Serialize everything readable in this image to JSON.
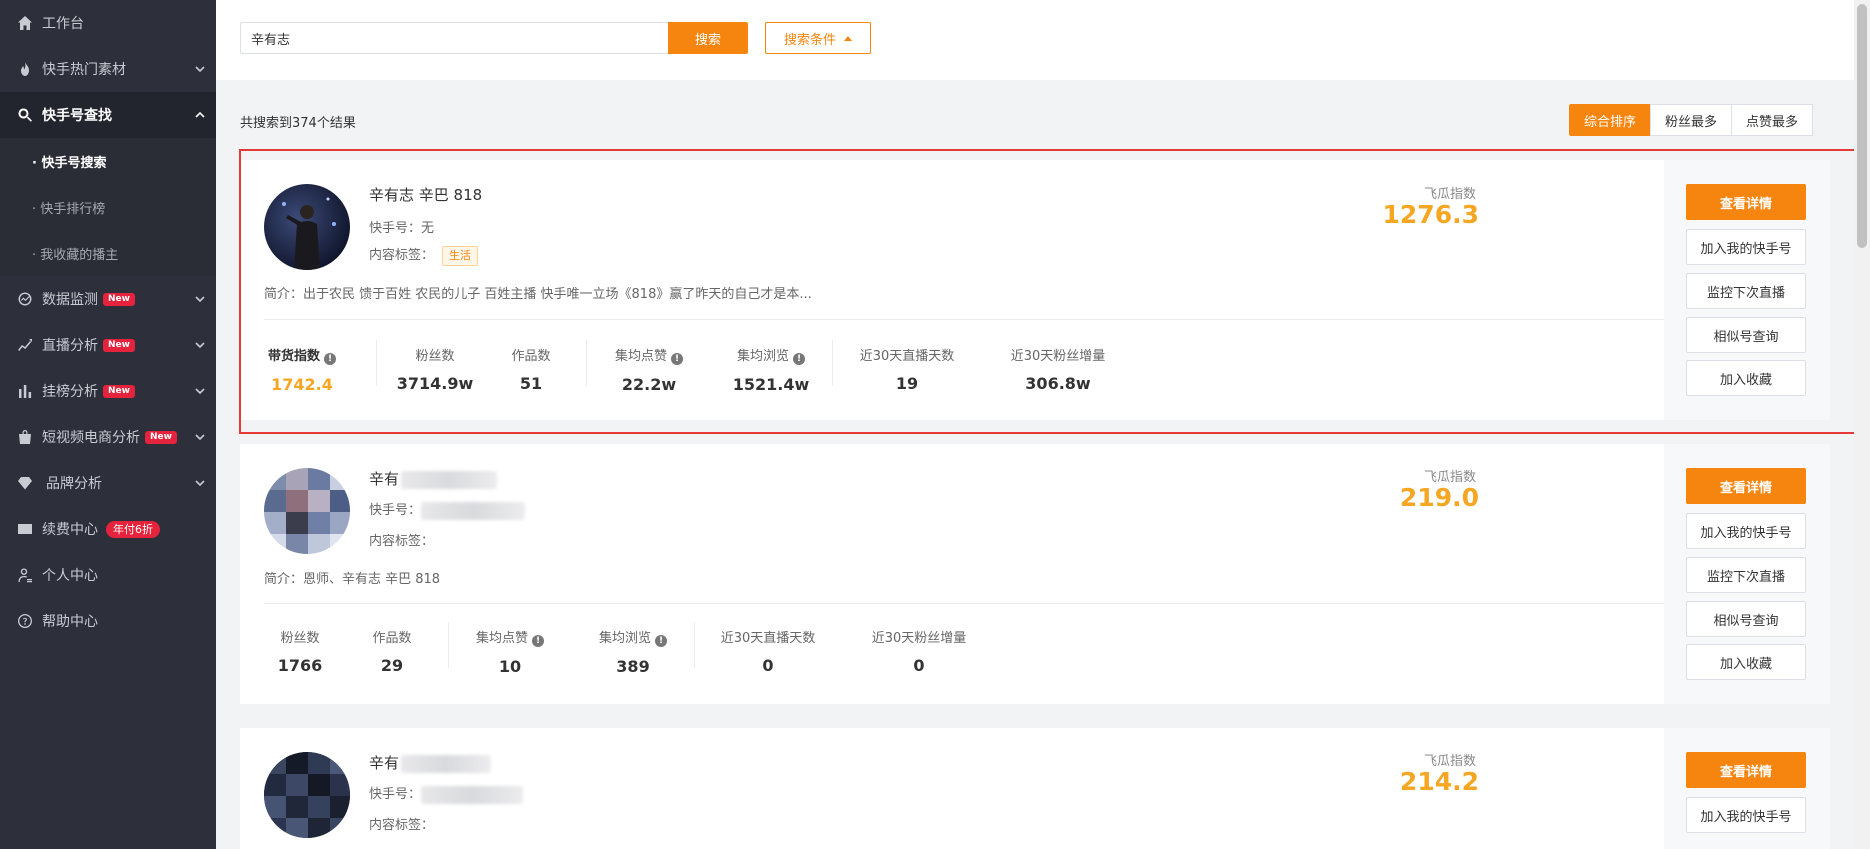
{
  "sidebar": {
    "items": [
      {
        "label": "工作台",
        "icon": "home-icon"
      },
      {
        "label": "快手热门素材",
        "icon": "fire-icon"
      },
      {
        "label": "快手号查找",
        "icon": "search-icon"
      },
      {
        "label": "数据监测",
        "icon": "monitor-icon",
        "badge": "New"
      },
      {
        "label": "直播分析",
        "icon": "trend-icon",
        "badge": "New"
      },
      {
        "label": "挂榜分析",
        "icon": "bar-icon",
        "badge": "New"
      },
      {
        "label": "短视频电商分析",
        "icon": "bag-icon",
        "badge": "New"
      },
      {
        "label": "品牌分析",
        "icon": "diamond-icon"
      },
      {
        "label": "续费中心",
        "icon": "card-icon",
        "badge": "年付6折"
      },
      {
        "label": "个人中心",
        "icon": "user-icon"
      },
      {
        "label": "帮助中心",
        "icon": "help-icon"
      }
    ],
    "sub_items": [
      "· 快手号搜索",
      "· 快手排行榜",
      "· 我收藏的播主"
    ]
  },
  "search": {
    "value": "辛有志",
    "button": "搜索",
    "conditions": "搜索条件"
  },
  "results": {
    "count_text": "共搜索到374个结果",
    "sort": [
      "综合排序",
      "粉丝最多",
      "点赞最多"
    ]
  },
  "labels": {
    "kuaishou_id": "快手号：",
    "content_tag": "内容标签：",
    "index_label": "飞瓜指数",
    "stat_sales": "带货指数",
    "stat_fans": "粉丝数",
    "stat_works": "作品数",
    "stat_likes": "集均点赞",
    "stat_views": "集均浏览",
    "stat_live_days": "近30天直播天数",
    "stat_fan_growth": "近30天粉丝增量"
  },
  "actions": [
    "查看详情",
    "加入我的快手号",
    "监控下次直播",
    "相似号查询",
    "加入收藏"
  ],
  "cards": [
    {
      "name": "辛有志 辛巴 818",
      "kuaishou_id": "快手号：无",
      "tag": "生活",
      "intro": "简介：出于农民 馈于百姓 农民的儿子 百姓主播 快手唯一立场《818》赢了昨天的自己才是本...",
      "index": "1276.3",
      "sales_index": "1742.4",
      "fans": "3714.9w",
      "works": "51",
      "likes": "22.2w",
      "views": "1521.4w",
      "live_days": "19",
      "fan_growth": "306.8w"
    },
    {
      "name": "辛有",
      "intro": "简介：恩师、辛有志 辛巴 818",
      "index": "219.0",
      "fans": "1766",
      "works": "29",
      "likes": "10",
      "views": "389",
      "live_days": "0",
      "fan_growth": "0"
    },
    {
      "name": "辛有",
      "index": "214.2"
    }
  ],
  "colors": {
    "accent": "#f5850f",
    "index": "#f5a623",
    "sidebar": "#2d2f3a",
    "highlight": "#e53935",
    "badge": "#e5233d"
  }
}
